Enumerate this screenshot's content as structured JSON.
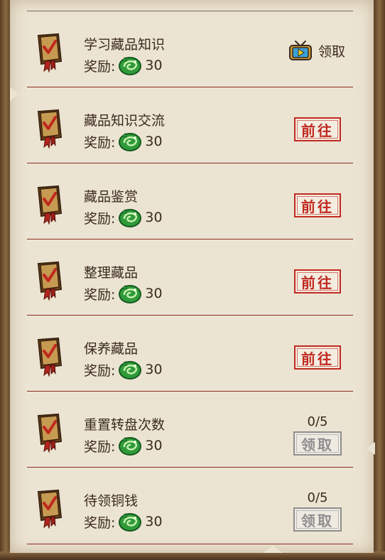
{
  "reward_label": "奖励:",
  "colors": {
    "divider": "#8b2a22",
    "go_button": "#c02a22",
    "disabled_button": "#8e8e8e",
    "paper": "#ece4d2"
  },
  "tasks": [
    {
      "title": "学习藏品知识",
      "reward": "30",
      "action": "video-claim",
      "action_label": "领取",
      "icon": "tv-icon"
    },
    {
      "title": "藏品知识交流",
      "reward": "30",
      "action": "goto",
      "action_label": "前往"
    },
    {
      "title": "藏品鉴赏",
      "reward": "30",
      "action": "goto",
      "action_label": "前往"
    },
    {
      "title": "整理藏品",
      "reward": "30",
      "action": "goto",
      "action_label": "前往"
    },
    {
      "title": "保养藏品",
      "reward": "30",
      "action": "goto",
      "action_label": "前往"
    },
    {
      "title": "重置转盘次数",
      "reward": "30",
      "action": "claim-disabled",
      "action_label": "领取",
      "progress": "0/5"
    },
    {
      "title": "待领铜钱",
      "reward": "30",
      "action": "claim-disabled",
      "action_label": "领取",
      "progress": "0/5"
    }
  ]
}
